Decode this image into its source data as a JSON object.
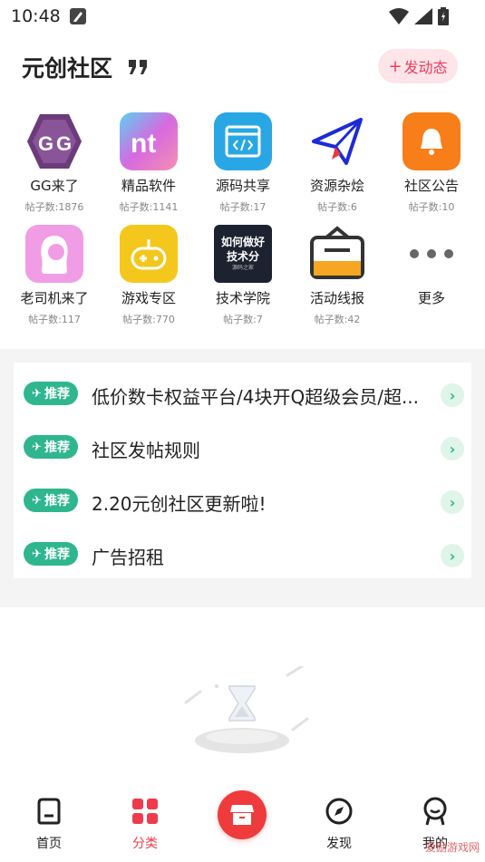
{
  "status_bar": {
    "time": "10:48"
  },
  "header": {
    "title": "元创社区",
    "post_button": "发动态",
    "post_plus": "+"
  },
  "categories": [
    {
      "name": "GG来了",
      "count": "帖子数:1876",
      "icon": "gg-logo-icon"
    },
    {
      "name": "精品软件",
      "count": "帖子数:1141",
      "icon": "nt-logo-icon"
    },
    {
      "name": "源码共享",
      "count": "帖子数:17",
      "icon": "code-window-icon"
    },
    {
      "name": "资源杂烩",
      "count": "帖子数:6",
      "icon": "paper-plane-icon"
    },
    {
      "name": "社区公告",
      "count": "帖子数:10",
      "icon": "bell-icon"
    },
    {
      "name": "老司机来了",
      "count": "帖子数:117",
      "icon": "girl-avatar-icon"
    },
    {
      "name": "游戏专区",
      "count": "帖子数:770",
      "icon": "gamepad-icon"
    },
    {
      "name": "技术学院",
      "count": "帖子数:7",
      "icon": "tech-board-icon",
      "board_line1": "如何做好",
      "board_line2": "技术分",
      "board_small": "源码之家"
    },
    {
      "name": "活动线报",
      "count": "帖子数:42",
      "icon": "ticket-box-icon"
    },
    {
      "name": "更多",
      "count": "",
      "icon": "more-dots-icon"
    }
  ],
  "notices": [
    {
      "tag": "推荐",
      "text": "低价数卡权益平台/4块开Q超级会员/超..."
    },
    {
      "tag": "推荐",
      "text": "社区发帖规则"
    },
    {
      "tag": "推荐",
      "text": "2.20元创社区更新啦!"
    },
    {
      "tag": "推荐",
      "text": "广告招租"
    }
  ],
  "bottom_nav": {
    "home": "首页",
    "category": "分类",
    "discover": "发现",
    "mine": "我的"
  },
  "watermark": "爱励游戏网",
  "colors": {
    "accent": "#ef3b4b",
    "green": "#2fb68e",
    "pink_bg": "#fde5ea"
  }
}
